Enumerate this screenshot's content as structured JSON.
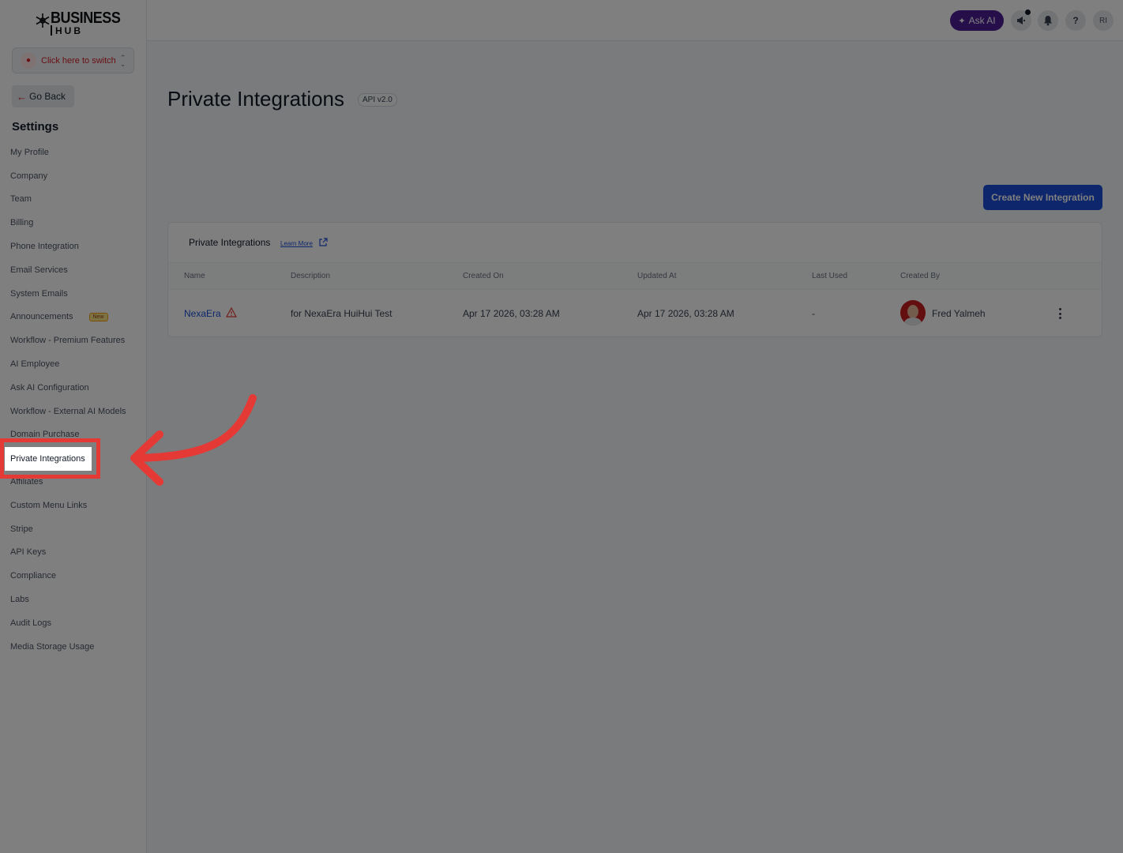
{
  "brand": {
    "word1": "BUSINESS",
    "word2": "HUB"
  },
  "switcher": {
    "label": "Click here to switch"
  },
  "go_back": {
    "label": "Go Back"
  },
  "settings_title": "Settings",
  "nav": {
    "items": [
      {
        "label": "My Profile"
      },
      {
        "label": "Company"
      },
      {
        "label": "Team"
      },
      {
        "label": "Billing"
      },
      {
        "label": "Phone Integration"
      },
      {
        "label": "Email Services"
      },
      {
        "label": "System Emails"
      },
      {
        "label": "Announcements",
        "badge": "New"
      },
      {
        "label": "Workflow - Premium Features"
      },
      {
        "label": "AI Employee"
      },
      {
        "label": "Ask AI Configuration"
      },
      {
        "label": "Workflow - External AI Models"
      },
      {
        "label": "Domain Purchase"
      },
      {
        "label": "Private Integrations"
      },
      {
        "label": "Affiliates"
      },
      {
        "label": "Custom Menu Links"
      },
      {
        "label": "Stripe"
      },
      {
        "label": "API Keys"
      },
      {
        "label": "Compliance"
      },
      {
        "label": "Labs"
      },
      {
        "label": "Audit Logs"
      },
      {
        "label": "Media Storage Usage"
      }
    ]
  },
  "topbar": {
    "ask_ai": "Ask AI",
    "help": "?",
    "user_initials": "RI"
  },
  "page": {
    "title": "Private Integrations",
    "api_version": "API v2.0"
  },
  "create_button": "Create New Integration",
  "card": {
    "title": "Private Integrations",
    "learn_more": "Learn More",
    "columns": [
      "Name",
      "Description",
      "Created On",
      "Updated At",
      "Last Used",
      "Created By"
    ],
    "rows": [
      {
        "name": "NexaEra",
        "description": "for NexaEra HuiHui Test",
        "created_on": "Apr 17 2026, 03:28 AM",
        "updated_at": "Apr 17 2026, 03:28 AM",
        "last_used": "-",
        "created_by": "Fred Yalmeh"
      }
    ]
  },
  "icons": {
    "logo": "snowflake-gear-icon",
    "switcher": "location-pin-icon",
    "back": "arrow-left-icon",
    "ask_ai": "sparkle-icon",
    "megaphone": "megaphone-icon",
    "bell": "bell-icon",
    "external": "external-link-icon",
    "warning": "warning-triangle-icon",
    "more": "kebab-menu-icon"
  },
  "colors": {
    "accent_blue": "#1d4ed8",
    "ask_ai_purple": "#4c1d95",
    "highlight_red": "#e53935"
  }
}
